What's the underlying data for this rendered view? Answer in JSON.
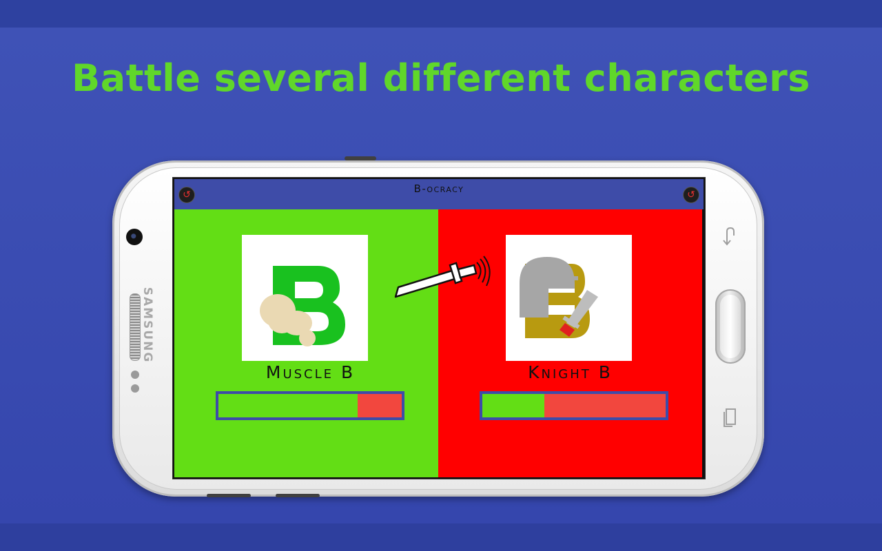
{
  "headline": "Battle several different characters",
  "device": {
    "brand": "SAMSUNG"
  },
  "app": {
    "title": "B-ocracy",
    "left_button_icon": "restart-icon",
    "right_button_icon": "restart-icon"
  },
  "players": [
    {
      "name": "Muscle B",
      "health_fraction": 0.76,
      "panel_color": "#63de15",
      "icon": "muscle-b-portrait"
    },
    {
      "name": "Knight B",
      "health_fraction": 0.34,
      "panel_color": "#ff0000",
      "icon": "knight-b-portrait"
    }
  ],
  "colors": {
    "background": "#3f52b6",
    "headline": "#60d72a",
    "appbar": "#3e4ca8",
    "health_fill": "#63de15",
    "health_empty": "#f2473e"
  },
  "nav_icons": [
    "back-icon",
    "recent-apps-icon"
  ]
}
